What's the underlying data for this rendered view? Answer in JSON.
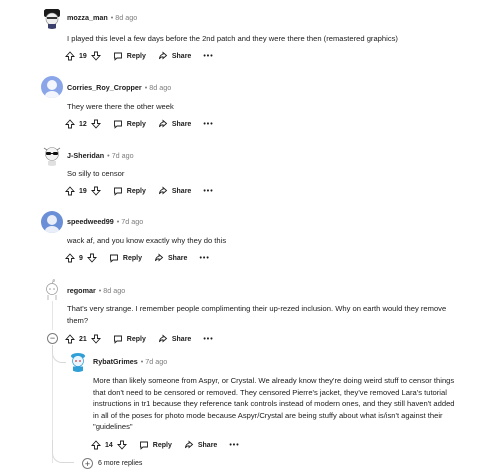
{
  "comments": [
    {
      "author": "mozza_man",
      "time": "8d ago",
      "body": "I played this level a few days before the 2nd patch and they were there then (remastered graphics)",
      "votes": "19",
      "reply": "Reply",
      "share": "Share",
      "more": "•••"
    },
    {
      "author": "Corries_Roy_Cropper",
      "time": "8d ago",
      "body": "They were there the other week",
      "votes": "12",
      "reply": "Reply",
      "share": "Share",
      "more": "•••"
    },
    {
      "author": "J-Sheridan",
      "time": "7d ago",
      "body": "So silly to censor",
      "votes": "19",
      "reply": "Reply",
      "share": "Share",
      "more": "•••"
    },
    {
      "author": "speedweed99",
      "time": "7d ago",
      "body": "wack af, and you know exactly why they do this",
      "votes": "9",
      "reply": "Reply",
      "share": "Share",
      "more": "•••"
    },
    {
      "author": "regomar",
      "time": "8d ago",
      "body_line1": "That's very strange. I remember people complimenting their up-rezed inclusion. Why on earth would they remove",
      "body_line2": "them?",
      "votes": "21",
      "reply": "Reply",
      "share": "Share",
      "more": "•••"
    },
    {
      "author": "RybatGrimes",
      "time": "7d ago",
      "body_lines": [
        "More than likely someone from Aspyr, or Crystal. We already know they're doing weird stuff to censor things",
        "that don't need to be censored or removed. They censored Pierre's jacket, they've removed Lara's tutorial",
        "instructions in tr1 because they reference tank controls instead of modern ones, and they still haven't added",
        "in all of the poses for photo mode because Aspyr/Crystal are being stuffy about what is/isn't against their",
        "\"guidelines\""
      ],
      "votes": "14",
      "reply": "Reply",
      "share": "Share",
      "more": "•••"
    }
  ],
  "thread": {
    "collapse_symbol": "−",
    "more_replies_symbol": "+",
    "more_replies": "6 more replies"
  },
  "colors": {
    "meta": "#7c7c7c",
    "text": "#1c1c1c",
    "speedweed_avatar": "#6b8fd6",
    "corries_avatar": "#8aa6e8",
    "ryba_avatar": "#2f9fd6"
  }
}
